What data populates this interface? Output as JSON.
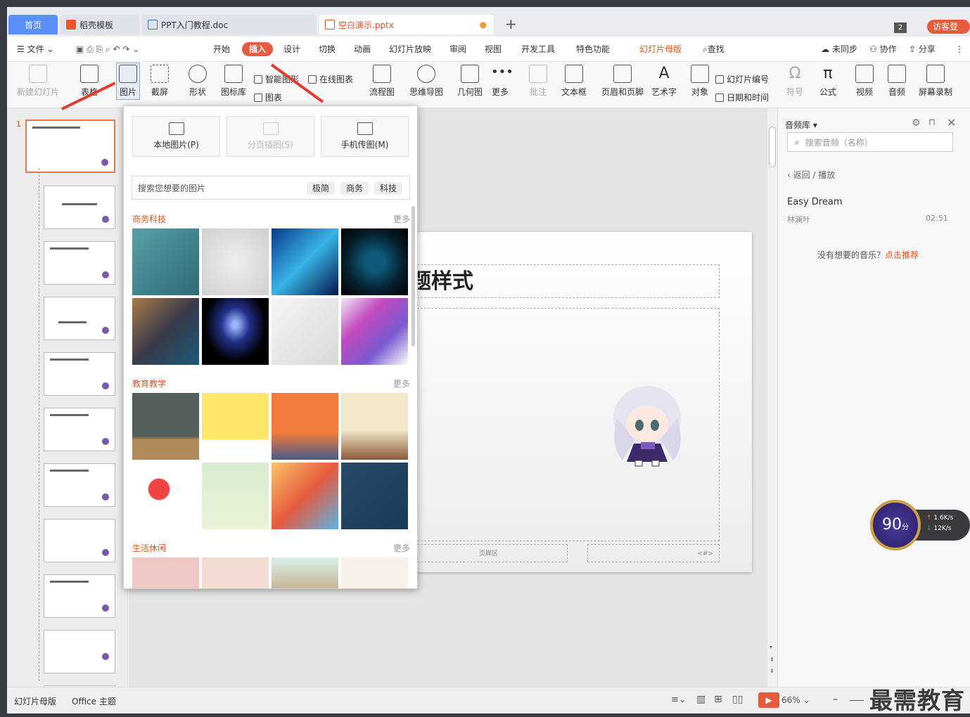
{
  "tabs": {
    "home": "首页",
    "t1": "稻壳模板",
    "t2": "PPT入门教程.doc",
    "t3": "空白演示.pptx",
    "count": "2",
    "login": "访客登录"
  },
  "menu": {
    "file": "文件",
    "start": "开始",
    "insert": "插入",
    "design": "设计",
    "switch": "切换",
    "anim": "动画",
    "show": "幻灯片放映",
    "review": "审阅",
    "view": "视图",
    "dev": "开发工具",
    "special": "特色功能",
    "master": "幻灯片母版",
    "find": "查找",
    "sync": "未同步",
    "collab": "协作",
    "share": "分享"
  },
  "ribbon": {
    "newslide": "新建幻灯片",
    "table": "表格",
    "picture": "图片",
    "screenshot": "截屏",
    "shape": "形状",
    "iconlib": "图标库",
    "smart": "智能图形",
    "chart": "图表",
    "online": "在线图表",
    "flow": "流程图",
    "mind": "思维导图",
    "geo": "几何图",
    "more": "更多",
    "comment": "批注",
    "textbox": "文本框",
    "header": "页眉和页脚",
    "art": "艺术字",
    "object": "对象",
    "slideno": "幻灯片编号",
    "datetime": "日期和时间",
    "symbol": "符号",
    "formula": "公式",
    "video": "视频",
    "audio": "音频",
    "record": "屏幕录制"
  },
  "popup": {
    "local": "本地图片(P)",
    "page": "分页插图(S)",
    "phone": "手机传图(M)",
    "search": "搜索您想要的图片",
    "chip1": "极简",
    "chip2": "商务",
    "chip3": "科技",
    "sec1": "商务科技",
    "sec2": "教育教学",
    "sec3": "生活休闲",
    "more": "更多"
  },
  "slide": {
    "title": "题样式",
    "footer": "页脚区",
    "num": "<#>"
  },
  "audio": {
    "title": "音频库",
    "search": "搜索音频（名称）",
    "back": "返回",
    "play": "播放",
    "song": "Easy Dream",
    "artist": "林澜叶",
    "duration": "02:51",
    "hint": "没有想要的音乐？",
    "recommend": "点击推荐"
  },
  "speed": {
    "score": "90",
    "unit": "分",
    "up": "1.6K/s",
    "down": "12K/s"
  },
  "status": {
    "master": "幻灯片母版",
    "theme": "Office 主题",
    "zoom": "66%"
  },
  "watermark": "最需教育",
  "colors": {
    "accent": "#e65a3d",
    "home": "#5b8ff9"
  }
}
